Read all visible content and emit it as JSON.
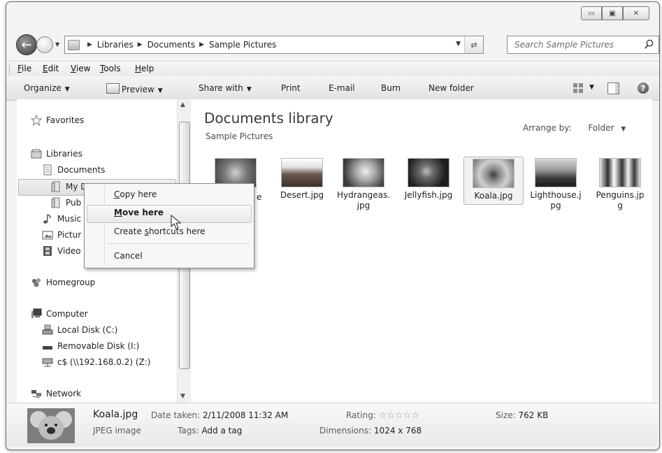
{
  "window": {
    "controls": [
      "▭",
      "▣",
      "✕"
    ]
  },
  "address_bar": {
    "crumbs": [
      "Libraries",
      "Documents",
      "Sample Pictures"
    ],
    "search_placeholder": "Search Sample Pictures"
  },
  "menu": {
    "items": [
      {
        "hot": "F",
        "rest": "ile"
      },
      {
        "hot": "E",
        "rest": "dit"
      },
      {
        "hot": "V",
        "rest": "iew"
      },
      {
        "hot": "T",
        "rest": "ools"
      },
      {
        "hot": "H",
        "rest": "elp"
      }
    ]
  },
  "toolbar": {
    "organize": "Organize",
    "preview": "Preview",
    "share_with": "Share with",
    "print": "Print",
    "email": "E-mail",
    "burn": "Burn",
    "new_folder": "New folder",
    "help": "?"
  },
  "nav": {
    "favorites": "Favorites",
    "libraries": "Libraries",
    "documents": "Documents",
    "my_docs": "My D",
    "public_docs": "Pub",
    "music": "Music",
    "pictures": "Pictur",
    "videos": "Video",
    "homegroup": "Homegroup",
    "computer": "Computer",
    "local_disk": "Local Disk (C:)",
    "removable_disk": "Removable Disk (I:)",
    "network_drive": "c$ (\\\\192.168.0.2) (Z:)",
    "network": "Network"
  },
  "content": {
    "title": "Documents library",
    "subtitle": "Sample Pictures",
    "arrange_label": "Arrange by:",
    "arrange_value": "Folder",
    "partial_label_1": "e",
    "partial_label_2": "g",
    "files": [
      {
        "line1": "Desert.jpg",
        "line2": ""
      },
      {
        "line1": "Hydrangeas.",
        "line2": "jpg"
      },
      {
        "line1": "Jellyfish.jpg",
        "line2": ""
      },
      {
        "line1": "Koala.jpg",
        "line2": ""
      },
      {
        "line1": "Lighthouse.j",
        "line2": "pg"
      },
      {
        "line1": "Penguins.jp",
        "line2": "g"
      }
    ]
  },
  "context_menu": {
    "copy": {
      "hot": "C",
      "rest": "opy here"
    },
    "move": {
      "hot": "M",
      "rest": "ove here"
    },
    "shortcut": {
      "pre": "Create ",
      "hot": "s",
      "rest": "hortcuts here"
    },
    "cancel": "Cancel"
  },
  "details": {
    "file_name": "Koala.jpg",
    "file_type": "JPEG image",
    "date_label": "Date taken:",
    "date_value": "2/11/2008 11:32 AM",
    "tags_label": "Tags:",
    "tags_value": "Add a tag",
    "rating_label": "Rating:",
    "dimensions_label": "Dimensions:",
    "dimensions_value": "1024 x 768",
    "size_label": "Size:",
    "size_value": "762 KB"
  },
  "colors": {
    "thumb_flower": "#6b6b6b",
    "thumb_desert": "#5a4a42",
    "thumb_hydrangea": "#9a9a9a",
    "thumb_jellyfish": "#3e3e3e",
    "thumb_koala": "#8a8a8a",
    "thumb_lighthouse": "#4a4a4a",
    "thumb_penguins": "#b5b5b5"
  }
}
